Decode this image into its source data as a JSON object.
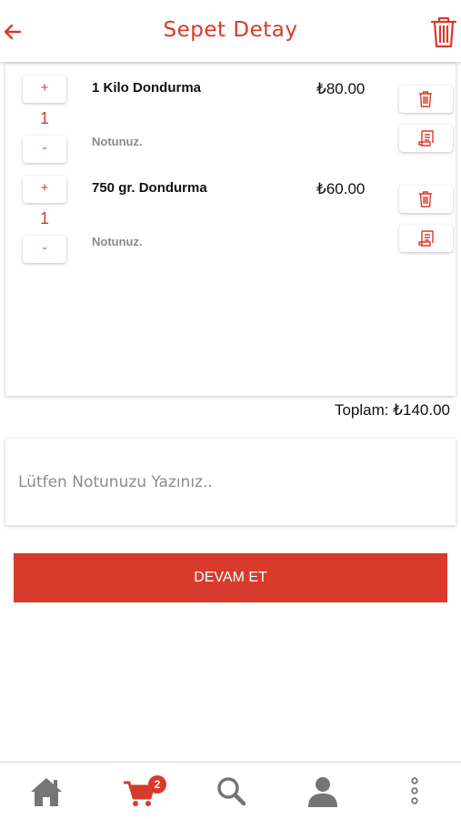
{
  "header": {
    "title": "Sepet Detay",
    "back_icon": "arrow-left-icon",
    "clear_icon": "trash-icon"
  },
  "colors": {
    "accent": "#d83a2b",
    "muted": "#8a8a8a",
    "nav_icon": "#757575"
  },
  "cart": {
    "items": [
      {
        "increment": "+",
        "quantity": "1",
        "decrement": "-",
        "name": "1 Kilo Dondurma",
        "price": "₺80.00",
        "note": "Notunuz."
      },
      {
        "increment": "+",
        "quantity": "1",
        "decrement": "-",
        "name": "750 gr. Dondurma",
        "price": "₺60.00",
        "note": "Notunuz."
      }
    ],
    "total": "Toplam: ₺140.00"
  },
  "note": {
    "placeholder": "Lütfen Notunuzu Yazınız.."
  },
  "cta": {
    "label": "DEVAM ET"
  },
  "nav": {
    "items": [
      {
        "icon": "home-icon"
      },
      {
        "icon": "cart-icon",
        "badge": "2"
      },
      {
        "icon": "search-icon"
      },
      {
        "icon": "user-icon"
      },
      {
        "icon": "more-vertical-icon"
      }
    ]
  }
}
